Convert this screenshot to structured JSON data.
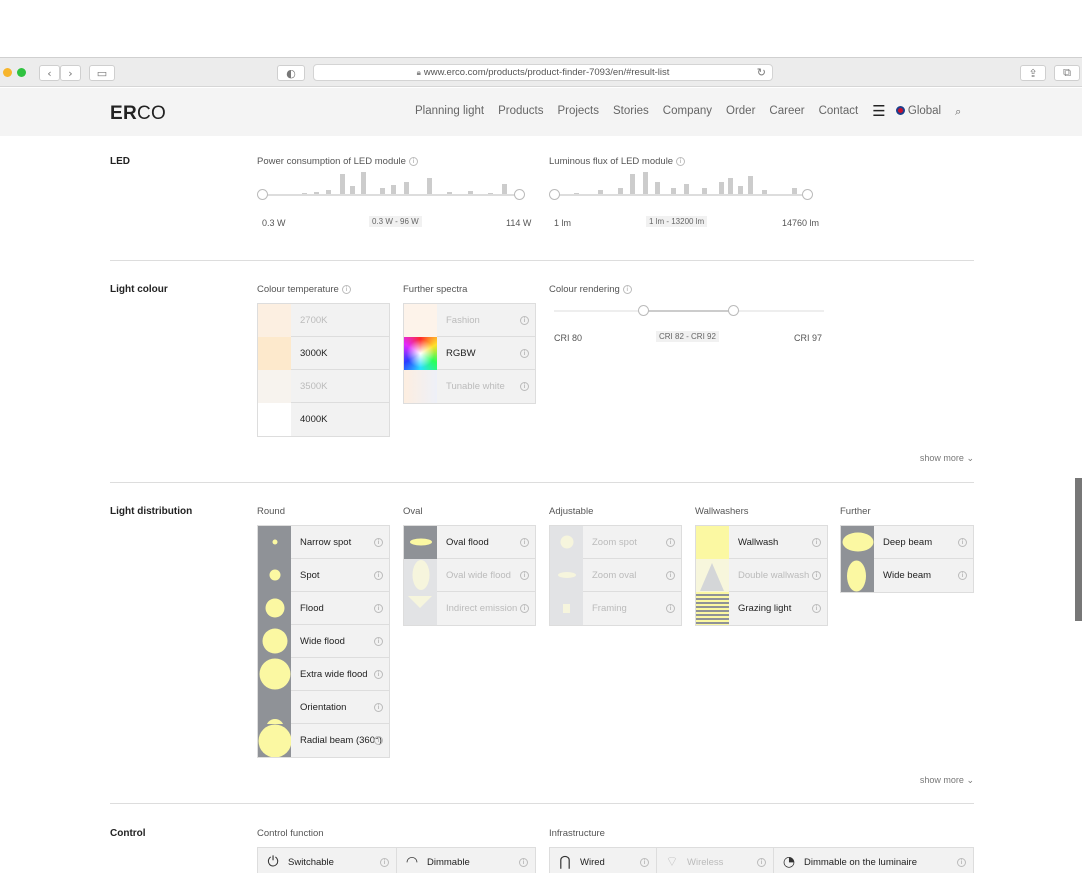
{
  "browser": {
    "url": "www.erco.com/products/product-finder-7093/en/#result-list",
    "traffic_lights": [
      "#f7b52c",
      "#2fc240"
    ],
    "buttons": {
      "back": "‹",
      "forward": "›",
      "sidebar": "▭",
      "shield": "◐",
      "reload": "↻",
      "share": "⇪",
      "tabs": "⧉"
    }
  },
  "site": {
    "logo_bold": "ER",
    "logo_rest": "CO",
    "nav": [
      "Planning light",
      "Products",
      "Projects",
      "Stories",
      "Company",
      "Order",
      "Career",
      "Contact"
    ],
    "global_label": "Global"
  },
  "led": {
    "title": "LED",
    "power": {
      "label": "Power consumption of LED module",
      "min": "0.3 W",
      "range": "0.3 W - 96 W",
      "max": "114 W"
    },
    "flux": {
      "label": "Luminous flux of LED module",
      "min": "1 lm",
      "range": "1 lm - 13200 lm",
      "max": "14760 lm"
    }
  },
  "light_colour": {
    "title": "Light colour",
    "colour_temperature": {
      "label": "Colour temperature",
      "items": [
        {
          "label": "2700K",
          "swatch": "#fcefe1",
          "enabled": false
        },
        {
          "label": "3000K",
          "swatch": "#fde9cc",
          "enabled": true
        },
        {
          "label": "3500K",
          "swatch": "#f7f3ee",
          "enabled": false
        },
        {
          "label": "4000K",
          "swatch": "#ffffff",
          "enabled": true
        }
      ]
    },
    "further_spectra": {
      "label": "Further spectra",
      "items": [
        {
          "label": "Fashion",
          "enabled": false
        },
        {
          "label": "RGBW",
          "enabled": true
        },
        {
          "label": "Tunable white",
          "enabled": false
        }
      ]
    },
    "colour_rendering": {
      "label": "Colour rendering",
      "min": "CRI 80",
      "range": "CRI 82 - CRI 92",
      "max": "CRI 97"
    },
    "show_more": "show more"
  },
  "light_distribution": {
    "title": "Light distribution",
    "round": {
      "label": "Round",
      "items": [
        {
          "label": "Narrow spot",
          "enabled": true
        },
        {
          "label": "Spot",
          "enabled": true
        },
        {
          "label": "Flood",
          "enabled": true
        },
        {
          "label": "Wide flood",
          "enabled": true
        },
        {
          "label": "Extra wide flood",
          "enabled": true
        },
        {
          "label": "Orientation",
          "enabled": true
        },
        {
          "label": "Radial beam (360°)",
          "enabled": true
        }
      ]
    },
    "oval": {
      "label": "Oval",
      "items": [
        {
          "label": "Oval flood",
          "enabled": true
        },
        {
          "label": "Oval wide flood",
          "enabled": false
        },
        {
          "label": "Indirect emission",
          "enabled": false
        }
      ]
    },
    "adjustable": {
      "label": "Adjustable",
      "items": [
        {
          "label": "Zoom spot",
          "enabled": false
        },
        {
          "label": "Zoom oval",
          "enabled": false
        },
        {
          "label": "Framing",
          "enabled": false
        }
      ]
    },
    "wallwashers": {
      "label": "Wallwashers",
      "items": [
        {
          "label": "Wallwash",
          "enabled": true
        },
        {
          "label": "Double wallwash",
          "enabled": false
        },
        {
          "label": "Grazing light",
          "enabled": true
        }
      ]
    },
    "further": {
      "label": "Further",
      "items": [
        {
          "label": "Deep beam",
          "enabled": true
        },
        {
          "label": "Wide beam",
          "enabled": true
        }
      ]
    },
    "show_more": "show more",
    "beam_color": "#fbf8a2"
  },
  "control": {
    "title": "Control",
    "control_function": {
      "label": "Control function",
      "items": [
        {
          "label": "Switchable",
          "icon": "power-icon",
          "glyph": "⏻"
        },
        {
          "label": "Dimmable",
          "icon": "dimmable-icon",
          "glyph": "◠"
        }
      ]
    },
    "infrastructure": {
      "label": "Infrastructure",
      "items": [
        {
          "label": "Wired",
          "icon": "plug-icon",
          "glyph": "⋂",
          "enabled": true
        },
        {
          "label": "Wireless",
          "icon": "wifi-icon",
          "glyph": "⌔",
          "enabled": false
        },
        {
          "label": "Dimmable on the luminaire",
          "icon": "dial-icon",
          "glyph": "◔",
          "enabled": true
        }
      ]
    }
  },
  "info_glyph": "i"
}
